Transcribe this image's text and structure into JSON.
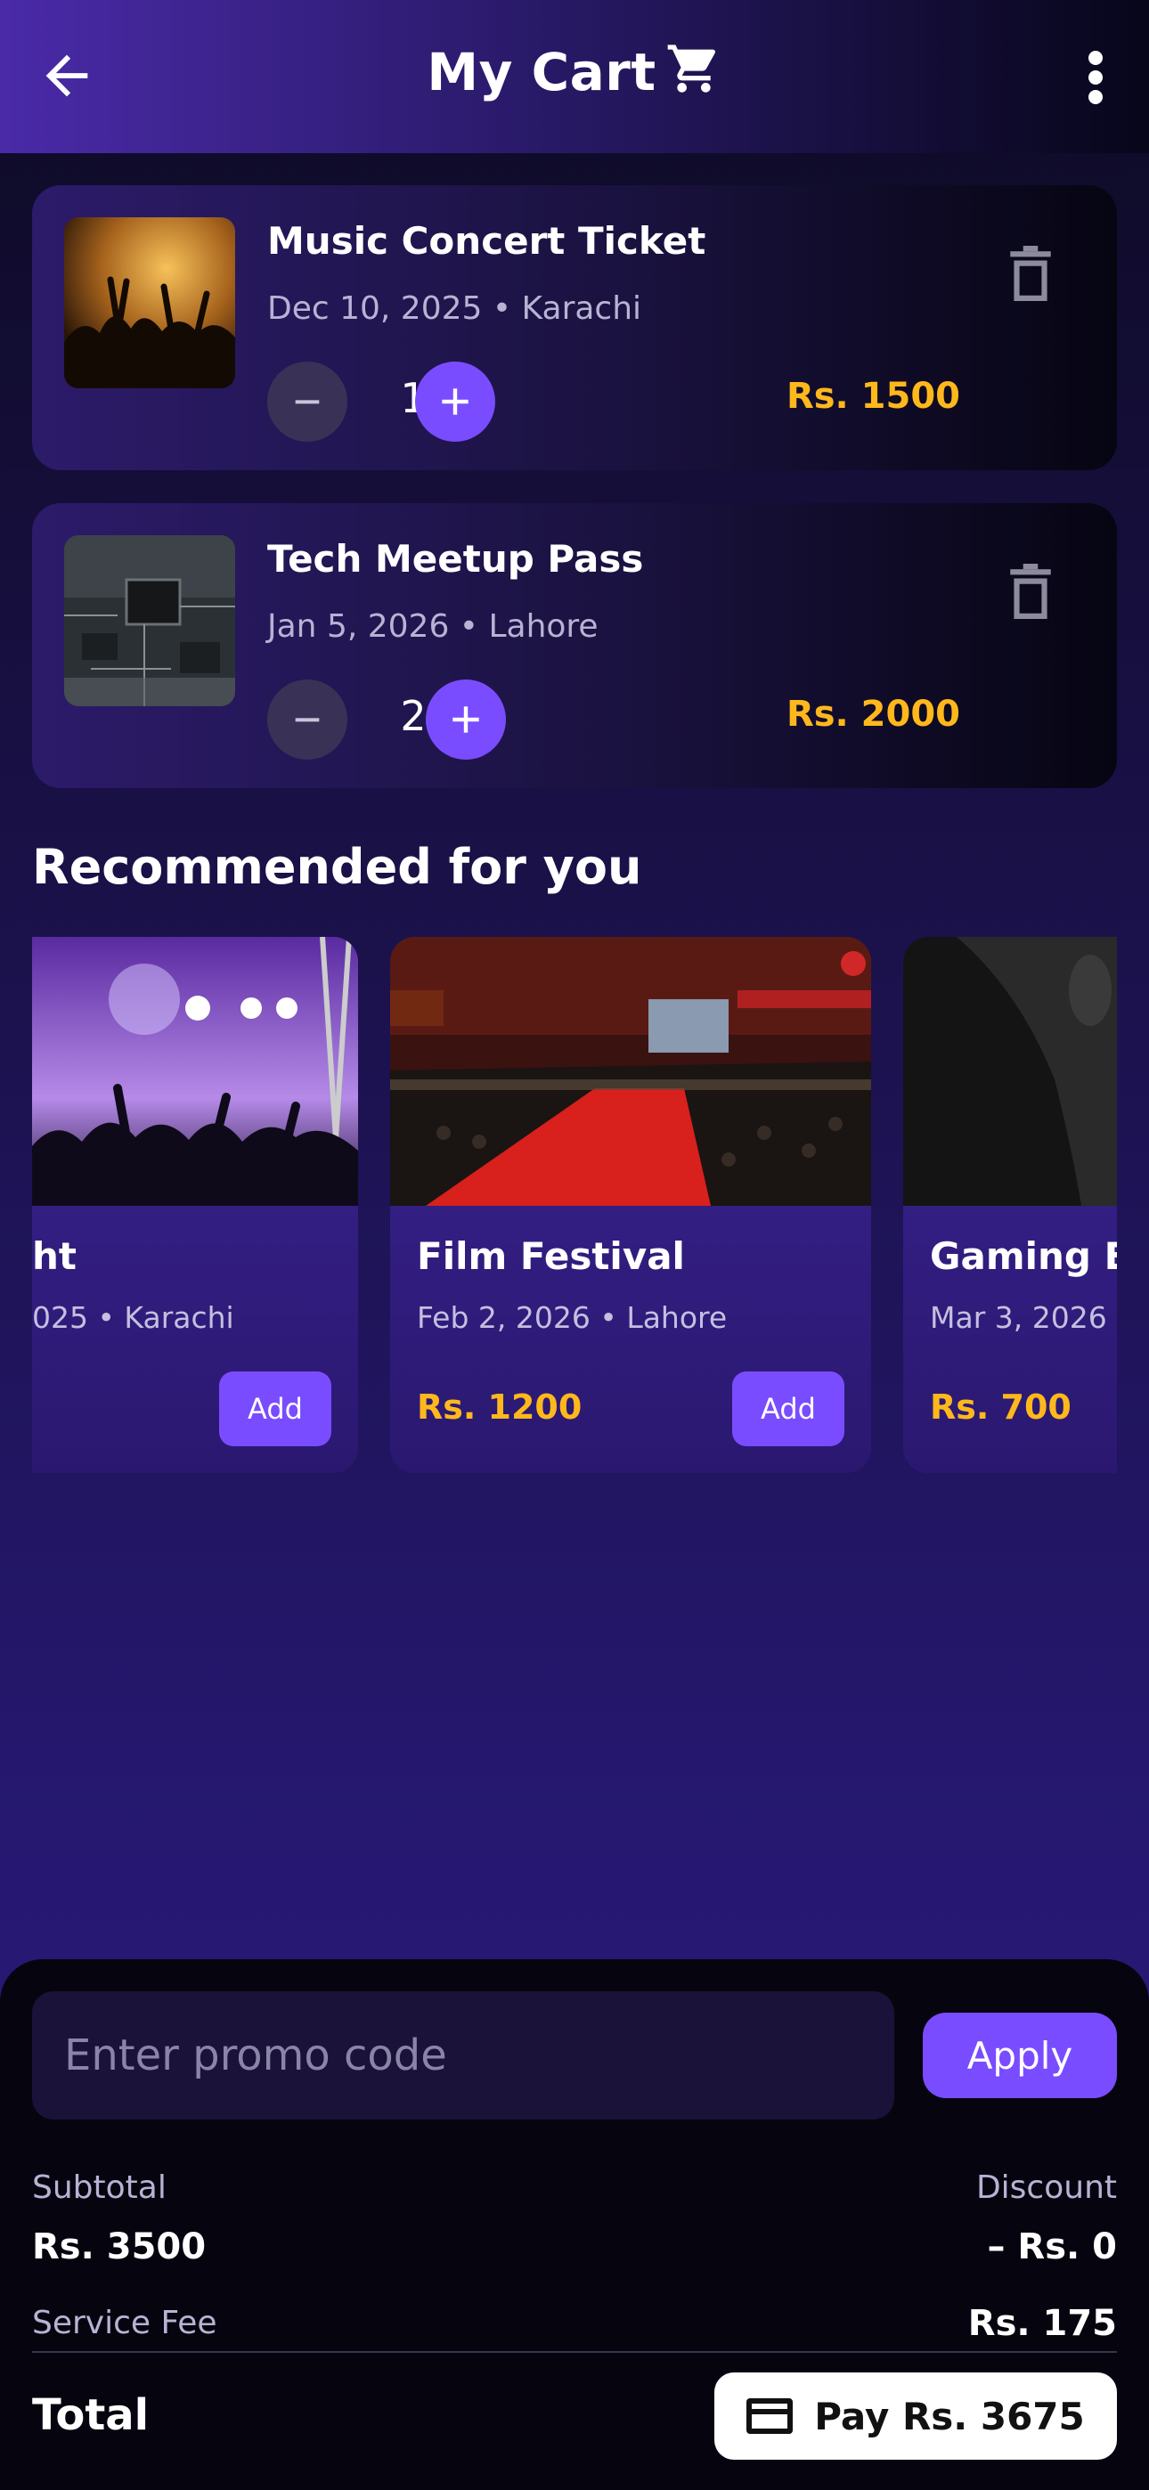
{
  "header": {
    "title": "My Cart"
  },
  "cart": [
    {
      "name": "Music Concert Ticket",
      "meta": "Dec 10, 2025 • Karachi",
      "qty": "1",
      "price": "Rs. 1500"
    },
    {
      "name": "Tech Meetup Pass",
      "meta": "Jan 5, 2026 • Lahore",
      "qty": "2",
      "price": "Rs. 2000"
    }
  ],
  "recommended": {
    "title": "Recommended for you",
    "items": [
      {
        "name": "ht",
        "meta": "025 • Karachi",
        "price": "",
        "add": "Add"
      },
      {
        "name": "Film Festival",
        "meta": "Feb 2, 2026 • Lahore",
        "price": "Rs. 1200",
        "add": "Add"
      },
      {
        "name": "Gaming E",
        "meta": "Mar 3, 2026 •",
        "price": "Rs. 700",
        "add": ""
      }
    ]
  },
  "summary": {
    "promo_placeholder": "Enter promo code",
    "apply_label": "Apply",
    "subtotal_label": "Subtotal",
    "subtotal_value": "Rs. 3500",
    "discount_label": "Discount",
    "discount_value": "– Rs. 0",
    "service_fee_label": "Service Fee",
    "service_fee_value": "Rs. 175",
    "total_label": "Total",
    "pay_label": "Pay Rs. 3675"
  },
  "icons": [
    "arrow-left-icon",
    "cart-icon",
    "more-vert-icon",
    "trash-icon",
    "minus-icon",
    "plus-icon",
    "credit-card-icon"
  ],
  "colors": {
    "accent": "#7a4cff",
    "price": "#ffb81c"
  }
}
